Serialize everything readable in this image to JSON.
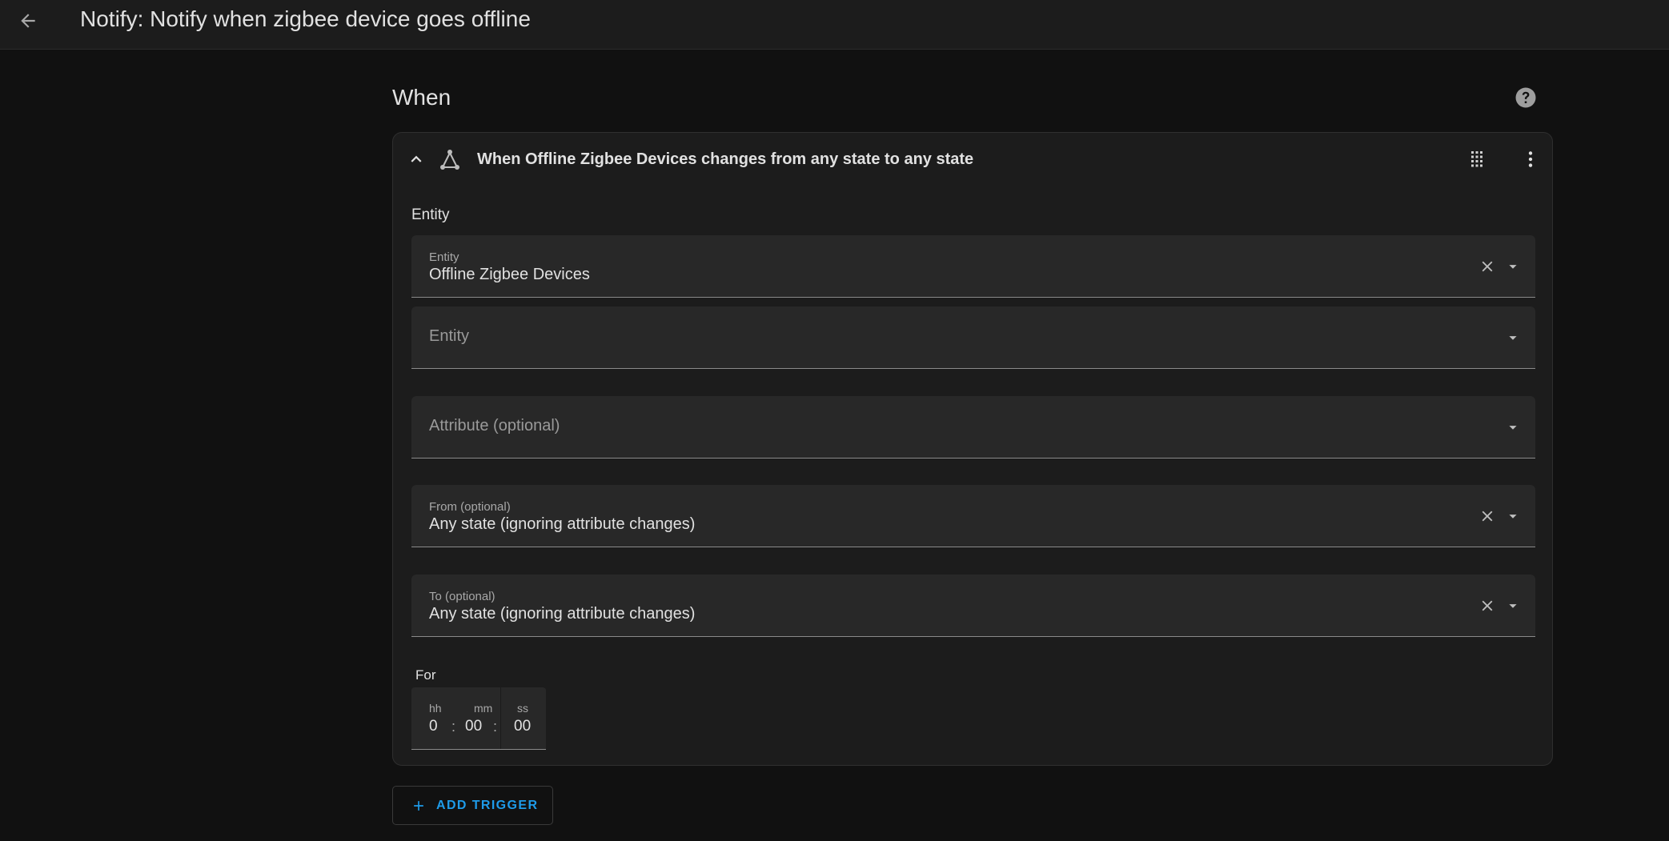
{
  "header": {
    "title": "Notify: Notify when zigbee device goes offline"
  },
  "section": {
    "title": "When"
  },
  "trigger": {
    "title": "When Offline Zigbee Devices changes from any state to any state",
    "entity_heading": "Entity",
    "fields": [
      {
        "label": "Entity",
        "value": "Offline Zigbee Devices",
        "placeholder": ""
      },
      {
        "label": "",
        "value": "",
        "placeholder": "Entity"
      },
      {
        "label": "",
        "value": "",
        "placeholder": "Attribute (optional)"
      },
      {
        "label": "From (optional)",
        "value": "Any state (ignoring attribute changes)",
        "placeholder": ""
      },
      {
        "label": "To (optional)",
        "value": "Any state (ignoring attribute changes)",
        "placeholder": ""
      }
    ],
    "duration": {
      "label": "For",
      "hours_label": "hh",
      "hours": "0",
      "minutes_label": "mm",
      "minutes": "00",
      "seconds_label": "ss",
      "seconds": "00",
      "separator": ":"
    }
  },
  "actions": {
    "add_trigger_label": "ADD TRIGGER"
  },
  "icons": {
    "back": "arrow-left-icon",
    "help": "help-circle-icon",
    "collapse": "chevron-up-icon",
    "trigger_type": "state-trigger-icon",
    "drag": "drag-handle-icon",
    "menu": "dots-vertical-icon",
    "clear": "close-icon",
    "dropdown": "menu-down-icon",
    "add": "plus-icon"
  },
  "colors": {
    "background": "#111111",
    "card": "#1c1c1c",
    "field": "#282828",
    "accent": "#1e9be9",
    "text": "#e1e1e1",
    "muted": "#9a9a9a"
  }
}
